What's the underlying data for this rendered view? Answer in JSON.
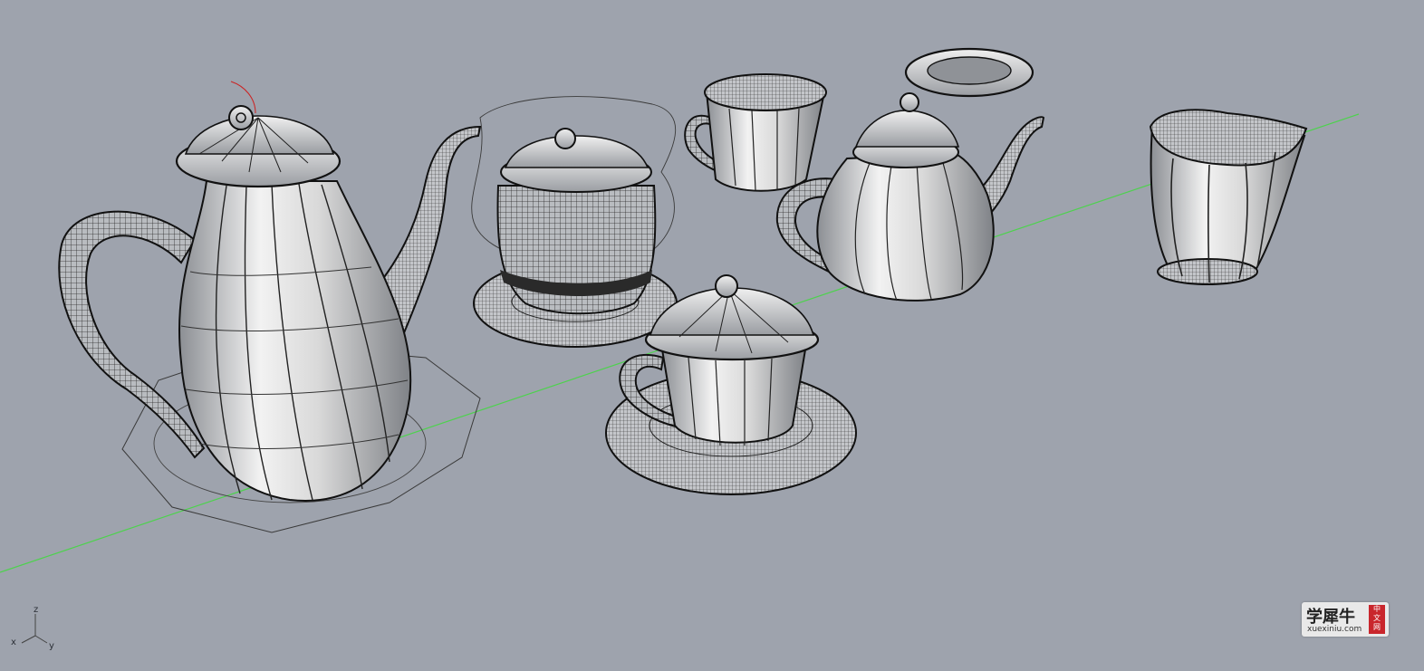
{
  "viewport": {
    "background": "#9ea3ad",
    "world_axis_color": "#4dd24d",
    "objects": [
      "coffee-pot",
      "sugar-bowl",
      "teacup-small",
      "saucer-lid",
      "teapot",
      "tall-cup",
      "cup-with-lid-on-saucer"
    ]
  },
  "axis_widget": {
    "x": "x",
    "y": "y",
    "z": "z"
  },
  "watermark": {
    "chinese": "学犀牛",
    "badge": [
      "中",
      "文",
      "网"
    ],
    "url": "xuexiniu.com"
  }
}
